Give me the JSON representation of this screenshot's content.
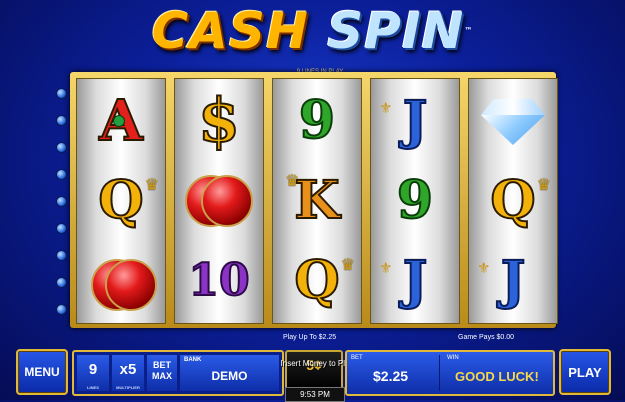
{
  "game": {
    "title_part1": "CASH",
    "title_part2": "SPIN",
    "title_mark": "™",
    "lines_in_play": "9 LINES IN PLAY"
  },
  "reels": [
    [
      "A",
      "Q",
      "ruby"
    ],
    [
      "$",
      "ruby",
      "10"
    ],
    [
      "9",
      "K",
      "Q"
    ],
    [
      "J",
      "9",
      "J"
    ],
    [
      "diamond",
      "Q",
      "J"
    ]
  ],
  "info": {
    "play_up_to": "Play Up To $2.25",
    "game_pays": "Game Pays $0.00"
  },
  "controls": {
    "menu_label": "MENU",
    "lines_value": "9",
    "lines_caption": "LINES",
    "multiplier_value": "x5",
    "multiplier_caption": "MULTIPLIER",
    "bet_max_line1": "BET",
    "bet_max_line2": "MAX",
    "bank_label": "BANK",
    "bank_value": "DEMO",
    "denom_value": "5¢",
    "insert_money": "Insert Money to Play",
    "clock": "9:53 PM",
    "bet_label": "BET",
    "bet_value": "$2.25",
    "win_label": "WIN",
    "win_value": "GOOD LUCK!",
    "play_label": "PLAY"
  },
  "colors": {
    "background": "#0b1f9a",
    "gold_border": "#e1b93a",
    "win_text": "#f7d84a"
  }
}
